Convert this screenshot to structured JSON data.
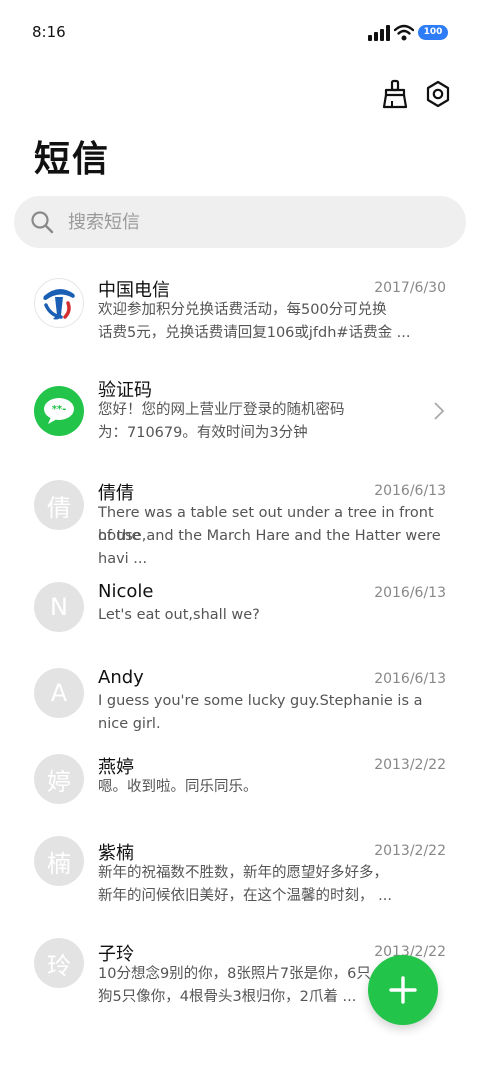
{
  "status": {
    "time": "8:16",
    "battery": "100"
  },
  "header": {
    "title": "短信"
  },
  "search": {
    "placeholder": "搜索短信"
  },
  "messages": [
    {
      "sender": "中国电信",
      "date": "2017/6/30",
      "line1": "欢迎参加积分兑换话费活动，每500分可兑换",
      "line2": "话费5元，兑换话费请回复106或jfdh#话费金 ...",
      "avatar": "telecom-logo"
    },
    {
      "sender": "验证码",
      "date": "",
      "line1": "您好！您的网上营业厅登录的随机密码",
      "line2": "为：710679。有效时间为3分钟",
      "avatar": "chat-bubble"
    },
    {
      "sender": "倩倩",
      "date": "2016/6/13",
      "line1": "There was a table set out under a tree in front of the",
      "line2": "house,and the March Hare and the Hatter were havi ...",
      "avatar": "倩"
    },
    {
      "sender": "Nicole",
      "date": "2016/6/13",
      "line1": "Let's eat out,shall we?",
      "line2": "",
      "avatar": "N"
    },
    {
      "sender": "Andy",
      "date": "2016/6/13",
      "line1": "I guess you're some lucky guy.Stephanie is a nice girl.",
      "line2": "",
      "avatar": "A"
    },
    {
      "sender": "燕婷",
      "date": "2013/2/22",
      "line1": "嗯。收到啦。同乐同乐。",
      "line2": "",
      "avatar": "婷"
    },
    {
      "sender": "紫楠",
      "date": "2013/2/22",
      "line1": "新年的祝福数不胜数，新年的愿望好多好多，",
      "line2": "新年的问候依旧美好，在这个温馨的时刻， ...",
      "avatar": "楠"
    },
    {
      "sender": "子玲",
      "date": "2013/2/22",
      "line1": "10分想念9别的你，8张照片7张是你，6只",
      "line2": "狗5只像你，4根骨头3根归你，2爪着 ...",
      "avatar": "玲"
    }
  ],
  "colors": {
    "accent": "#22c44a",
    "battery": "#2f7df6"
  }
}
